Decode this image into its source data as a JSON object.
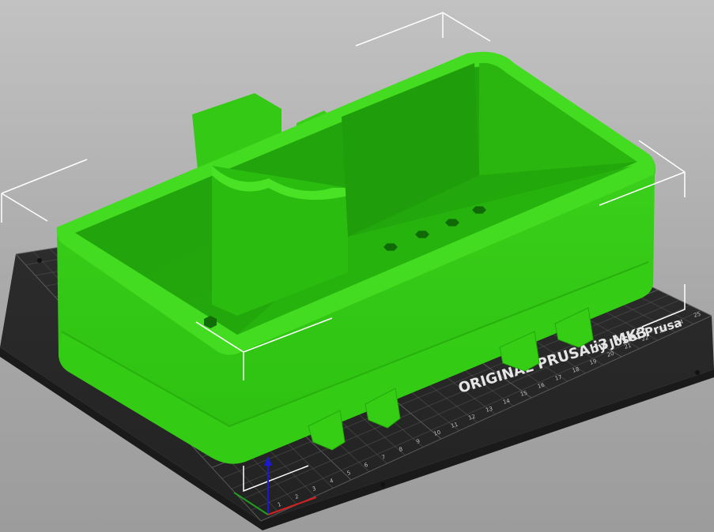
{
  "viewport": {
    "background_top": "#c2c2c2",
    "background_bottom": "#9c9c9c"
  },
  "bed": {
    "label_brand": "ORIGINAL PRUSA i3 MK3",
    "label_byline": "by Josef Prusa",
    "surface_color": "#2b2b2b",
    "grid_color": "#6a6a6a",
    "tick_label_color": "#bdbdbd",
    "tick_numbers": [
      "1",
      "2",
      "3",
      "4",
      "5",
      "6",
      "7",
      "8",
      "9",
      "10",
      "11",
      "12",
      "13",
      "14",
      "15",
      "16",
      "17",
      "18",
      "19",
      "20",
      "21",
      "22",
      "23",
      "24",
      "25"
    ]
  },
  "model": {
    "name": "tool-holder-box",
    "color_light": "#3fd61e",
    "color_mid": "#2fbf12",
    "color_dark": "#1f9a0a",
    "hex_holes": 5,
    "side_clips": 4
  },
  "bounding_box": {
    "color": "#ffffff"
  },
  "axes": {
    "x_color": "#d42020",
    "y_color": "#1ea01e",
    "z_color": "#1a1ad4"
  }
}
